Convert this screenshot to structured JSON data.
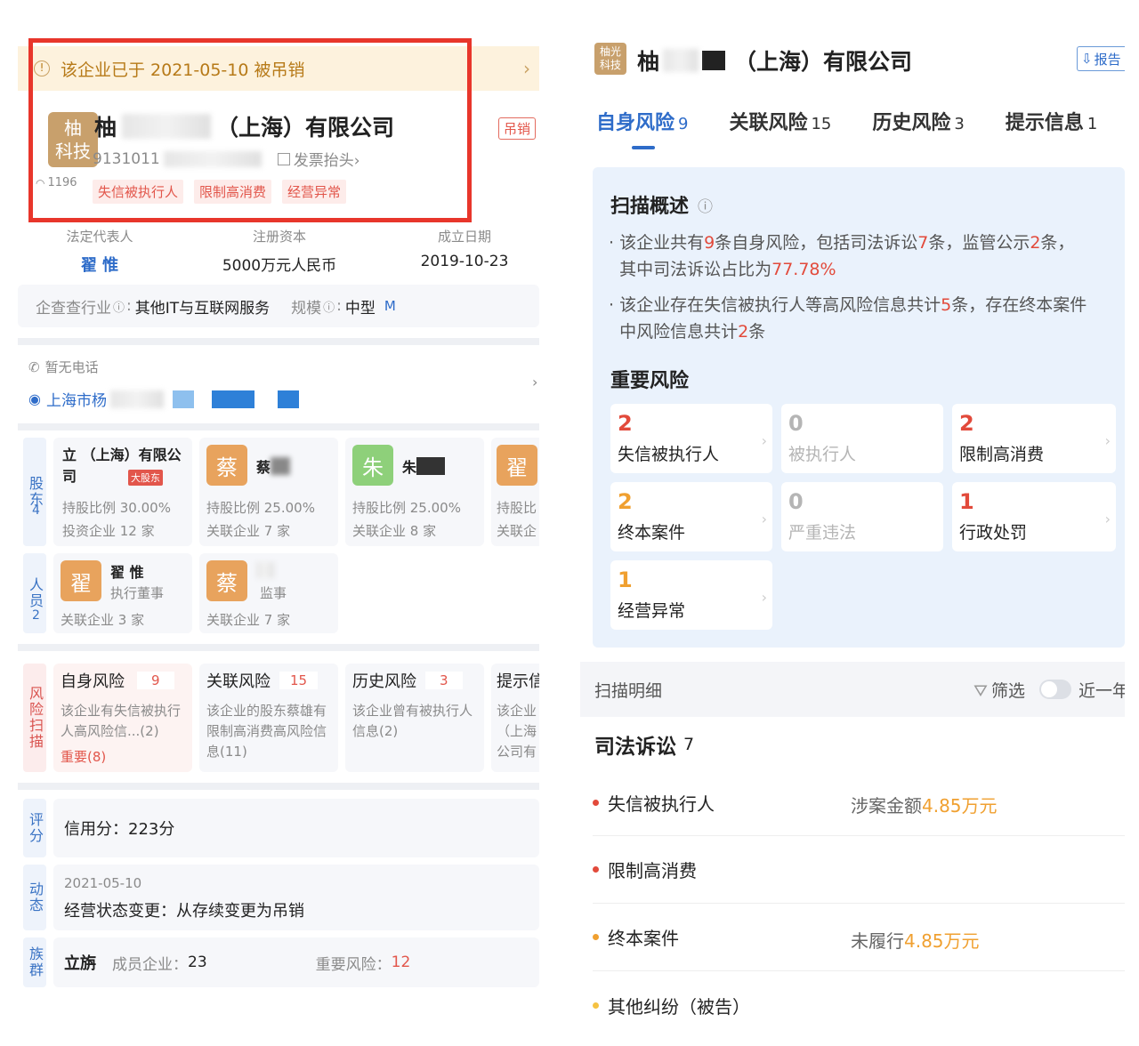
{
  "left": {
    "banner": {
      "text": "该企业已于 2021-05-10 被吊销",
      "chevron": "›"
    },
    "company": {
      "logo_line1": "柚",
      "logo_line2": "科技",
      "name_prefix": "柚",
      "name_suffix": "（上海）有限公司",
      "status_tag": "吊销",
      "credit_code": "9131011",
      "invoice_link": "发票抬头›",
      "views": "1196",
      "chips": [
        "失信被执行人",
        "限制高消费",
        "经营异常"
      ]
    },
    "basics": [
      {
        "label": "法定代表人",
        "value": "翟 惟"
      },
      {
        "label": "注册资本",
        "value": "5000万元人民币"
      },
      {
        "label": "成立日期",
        "value": "2019-10-23"
      }
    ],
    "industry": {
      "label": "企查查行业",
      "value": "其他IT与互联网服务",
      "scale_label": "规模",
      "scale_value": "中型",
      "scale_badge": "M"
    },
    "contact": {
      "phone": "暂无电话",
      "address": "上海市杨"
    },
    "shareholders": {
      "side_label": "股东",
      "count": "4",
      "items": [
        {
          "name": "立 （上海）有限公司",
          "badge": "大股东",
          "ratio": "持股比例 30.00%",
          "related": "投资企业 12 家"
        },
        {
          "avatar": "蔡",
          "name": "蔡",
          "ratio": "持股比例 25.00%",
          "related": "关联企业 7 家"
        },
        {
          "avatar": "朱",
          "name": "朱",
          "ratio": "持股比例 25.00%",
          "related": "关联企业 8 家"
        },
        {
          "avatar": "翟",
          "ratio": "持股比",
          "related": "关联企"
        }
      ]
    },
    "staff": {
      "side_label": "人员",
      "count": "2",
      "items": [
        {
          "avatar": "翟",
          "name": "翟 惟",
          "role": "执行董事",
          "related": "关联企业 3 家"
        },
        {
          "avatar": "蔡",
          "role": "监事",
          "related": "关联企业 7 家"
        }
      ]
    },
    "risk_scan": {
      "side_label": "风险扫描",
      "items": [
        {
          "title": "自身风险",
          "count": "9",
          "desc": "该企业有失信被执行人高风险信...(2)",
          "extra": "重要(8)"
        },
        {
          "title": "关联风险",
          "count": "15",
          "desc": "该企业的股东蔡雄有限制高消费高风险信息(11)"
        },
        {
          "title": "历史风险",
          "count": "3",
          "desc": "该企业曾有被执行人信息(2)"
        },
        {
          "title": "提示信",
          "desc": "该企业（上海公司有"
        }
      ]
    },
    "score": {
      "side_label": "评分",
      "text": "信用分：223分"
    },
    "dynamic": {
      "side_label": "动态",
      "date": "2021-05-10",
      "text": "经营状态变更：从存续变更为吊销"
    },
    "group": {
      "side_label": "族群",
      "name": "立旃",
      "members_label": "成员企业：",
      "members": "23",
      "risk_label": "重要风险：",
      "risk": "12"
    }
  },
  "right": {
    "header": {
      "logo_line1": "柚光",
      "logo_line2": "科技",
      "name_prefix": "柚",
      "name_suffix": "（上海）有限公司",
      "report_btn": "报告"
    },
    "tabs": [
      {
        "label": "自身风险",
        "count": "9"
      },
      {
        "label": "关联风险",
        "count": "15"
      },
      {
        "label": "历史风险",
        "count": "3"
      },
      {
        "label": "提示信息",
        "count": "1"
      }
    ],
    "overview": {
      "title": "扫描概述",
      "line1_a": "该企业共有",
      "line1_n1": "9",
      "line1_b": "条自身风险，包括司法诉讼",
      "line1_n2": "7",
      "line1_c": "条，监管公示",
      "line1_n3": "2",
      "line1_d": "条，",
      "line1_e": "其中司法诉讼占比为",
      "line1_pct": "77.78%",
      "line2_a": "该企业存在失信被执行人等高风险信息共计",
      "line2_n1": "5",
      "line2_b": "条，存在终本案件",
      "line2_c": "中风险信息共计",
      "line2_n2": "2",
      "line2_d": "条"
    },
    "important": {
      "title": "重要风险",
      "tiles": [
        {
          "num": "2",
          "label": "失信被执行人",
          "tone": "red"
        },
        {
          "num": "0",
          "label": "被执行人",
          "tone": "gray"
        },
        {
          "num": "2",
          "label": "限制高消费",
          "tone": "red"
        },
        {
          "num": "2",
          "label": "终本案件",
          "tone": "orange"
        },
        {
          "num": "0",
          "label": "严重违法",
          "tone": "gray"
        },
        {
          "num": "1",
          "label": "行政处罚",
          "tone": "red"
        },
        {
          "num": "1",
          "label": "经营异常",
          "tone": "orange"
        }
      ]
    },
    "detail_bar": {
      "title": "扫描明细",
      "filter": "筛选",
      "toggle_label": "近一年"
    },
    "judicial": {
      "title": "司法诉讼",
      "count": "7",
      "items": [
        {
          "label": "失信被执行人",
          "amount_label": "涉案金额",
          "amount": "4.85万元",
          "dot": "red"
        },
        {
          "label": "限制高消费",
          "dot": "red"
        },
        {
          "label": "终本案件",
          "amount_label": "未履行",
          "amount": "4.85万元",
          "dot": "orange"
        },
        {
          "label": "其他纠纷（被告）",
          "dot": "orange"
        }
      ]
    }
  }
}
